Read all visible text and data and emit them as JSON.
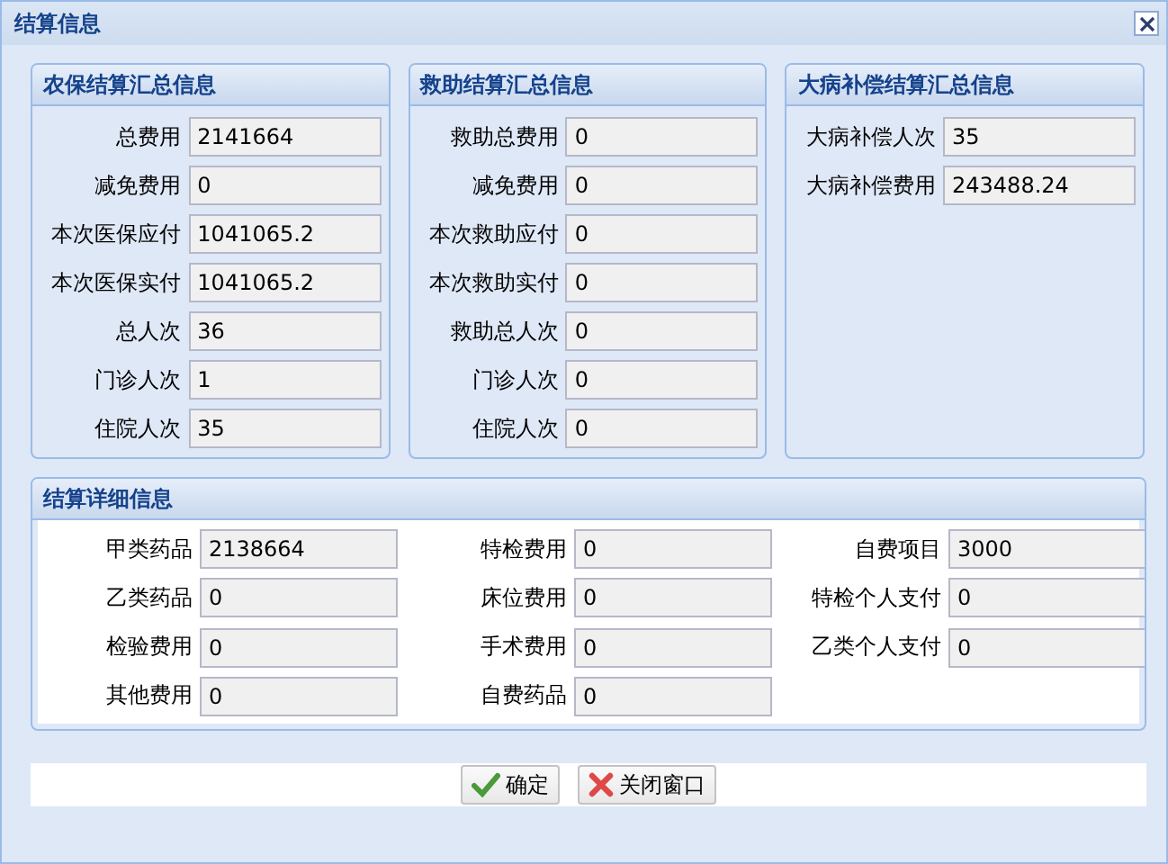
{
  "window": {
    "title": "结算信息"
  },
  "summary_panels": [
    {
      "title": "农保结算汇总信息",
      "fields": [
        {
          "label": "总费用",
          "value": "2141664"
        },
        {
          "label": "减免费用",
          "value": "0"
        },
        {
          "label": "本次医保应付",
          "value": "1041065.2"
        },
        {
          "label": "本次医保实付",
          "value": "1041065.2"
        },
        {
          "label": "总人次",
          "value": "36"
        },
        {
          "label": "门诊人次",
          "value": "1"
        },
        {
          "label": "住院人次",
          "value": "35"
        }
      ]
    },
    {
      "title": "救助结算汇总信息",
      "fields": [
        {
          "label": "救助总费用",
          "value": "0"
        },
        {
          "label": "减免费用",
          "value": "0"
        },
        {
          "label": "本次救助应付",
          "value": "0"
        },
        {
          "label": "本次救助实付",
          "value": "0"
        },
        {
          "label": "救助总人次",
          "value": "0"
        },
        {
          "label": "门诊人次",
          "value": "0"
        },
        {
          "label": "住院人次",
          "value": "0"
        }
      ]
    },
    {
      "title": "大病补偿结算汇总信息",
      "fields": [
        {
          "label": "大病补偿人次",
          "value": "35"
        },
        {
          "label": "大病补偿费用",
          "value": "243488.24"
        }
      ]
    }
  ],
  "detail_panel": {
    "title": "结算详细信息",
    "fields": [
      {
        "label": "甲类药品",
        "value": "2138664"
      },
      {
        "label": "特检费用",
        "value": "0"
      },
      {
        "label": "自费项目",
        "value": "3000"
      },
      {
        "label": "乙类药品",
        "value": "0"
      },
      {
        "label": "床位费用",
        "value": "0"
      },
      {
        "label": "特检个人支付",
        "value": "0"
      },
      {
        "label": "检验费用",
        "value": "0"
      },
      {
        "label": "手术费用",
        "value": "0"
      },
      {
        "label": "乙类个人支付",
        "value": "0"
      },
      {
        "label": "其他费用",
        "value": "0"
      },
      {
        "label": "自费药品",
        "value": "0"
      }
    ]
  },
  "buttons": [
    {
      "label": "确定",
      "kind": "confirm"
    },
    {
      "label": "关闭窗口",
      "kind": "close"
    }
  ]
}
